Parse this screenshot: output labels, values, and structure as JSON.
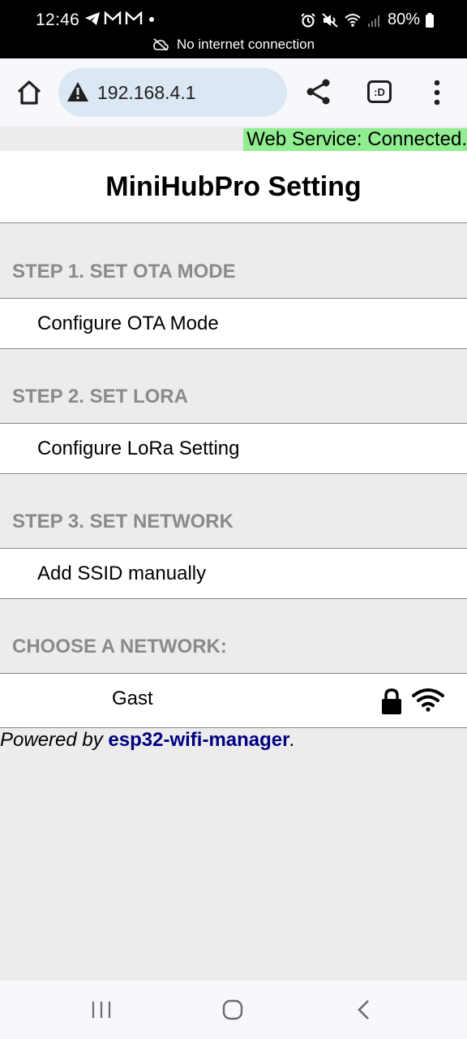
{
  "status_bar": {
    "time": "12:46",
    "battery": "80%",
    "no_internet": "No internet connection"
  },
  "browser": {
    "url": "192.168.4.1",
    "tab_badge": ":D"
  },
  "page": {
    "web_service_status": "Web Service: Connected.",
    "title": "MiniHubPro Setting",
    "sections": [
      {
        "heading": "STEP 1. SET OTA MODE",
        "item": "Configure OTA Mode"
      },
      {
        "heading": "STEP 2. SET LORA",
        "item": "Configure LoRa Setting"
      },
      {
        "heading": "STEP 3. SET NETWORK",
        "item": "Add SSID manually"
      }
    ],
    "choose_network_heading": "CHOOSE A NETWORK:",
    "networks": [
      {
        "ssid": "Gast",
        "secured": true
      }
    ],
    "footer": {
      "prefix": "Powered by ",
      "link_text": "esp32-wifi-manager",
      "suffix": "."
    }
  },
  "colors": {
    "status_ok_bg": "#90ee90",
    "link": "#000080",
    "section_heading": "#8a8a8a"
  }
}
